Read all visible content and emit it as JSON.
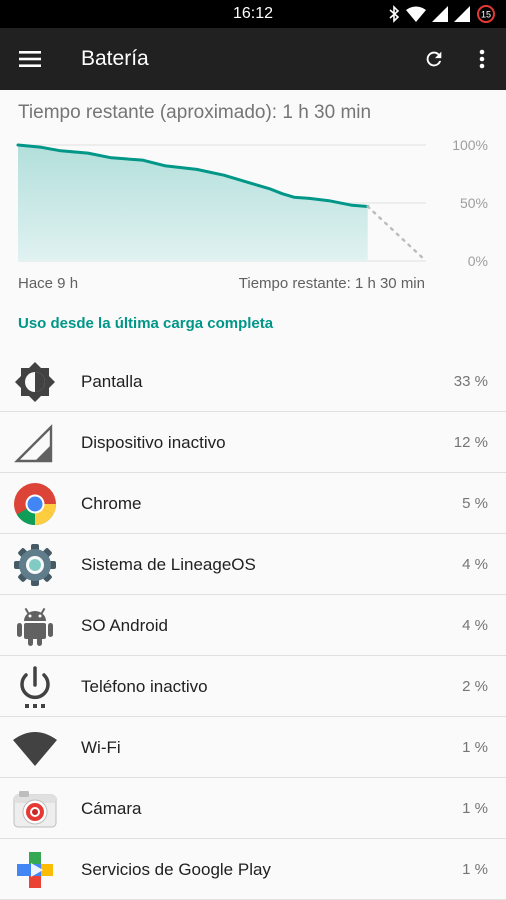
{
  "status_bar": {
    "time": "16:12",
    "icons": [
      "bluetooth-icon",
      "wifi-icon",
      "signal-icon",
      "signal-icon",
      "battery-saver-icon"
    ],
    "battery_level": "15"
  },
  "app_bar": {
    "title": "Batería",
    "actions": [
      "menu-icon",
      "refresh-icon",
      "more-vert-icon"
    ]
  },
  "battery": {
    "remaining_title": "Tiempo restante (aproximado): 1 h 30 min"
  },
  "chart_data": {
    "type": "area",
    "title": "",
    "x_range_label_start": "Hace 9 h",
    "x_range_label_end": "Tiempo restante: 1 h 30 min",
    "y_tick_labels": [
      "100%",
      "50%",
      "0%"
    ],
    "ylim": [
      0,
      100
    ],
    "grid": true,
    "series": [
      {
        "x_hours": [
          0,
          0.6,
          1.1,
          1.8,
          2.4,
          3.2,
          3.8,
          4.6,
          5.3,
          6.0,
          6.5,
          6.8,
          7.1,
          7.5,
          8.0,
          8.6,
          9.0
        ],
        "y": [
          100,
          98,
          95,
          93,
          89,
          87,
          82,
          79,
          74,
          67,
          62,
          58,
          55,
          54,
          52,
          48,
          47
        ]
      }
    ],
    "projection": {
      "x_hours": [
        9.0,
        10.5
      ],
      "y": [
        47,
        0
      ]
    },
    "colors": {
      "line": "#009688",
      "fill_top": "#b2dfdb",
      "fill_bottom": "#e0f2f1",
      "projection": "#bdbdbd"
    }
  },
  "usage": {
    "header": "Uso desde la última carga completa",
    "items": [
      {
        "name": "pantalla",
        "icon": "brightness-icon",
        "label": "Pantalla",
        "value": "33 %"
      },
      {
        "name": "dispositivo-inactivo",
        "icon": "cell-standby-icon",
        "label": "Dispositivo inactivo",
        "value": "12 %"
      },
      {
        "name": "chrome",
        "icon": "chrome-icon",
        "label": "Chrome",
        "value": "5 %"
      },
      {
        "name": "sistema-lineageos",
        "icon": "gear-icon",
        "label": "Sistema de LineageOS",
        "value": "4 %"
      },
      {
        "name": "so-android",
        "icon": "android-icon",
        "label": "SO Android",
        "value": "4 %"
      },
      {
        "name": "telefono-inactivo",
        "icon": "power-icon",
        "label": "Teléfono inactivo",
        "value": "2 %"
      },
      {
        "name": "wifi",
        "icon": "wifi-icon",
        "label": "Wi-Fi",
        "value": "1 %"
      },
      {
        "name": "camara",
        "icon": "camera-icon",
        "label": "Cámara",
        "value": "1 %"
      },
      {
        "name": "google-play-services",
        "icon": "google-play-services-icon",
        "label": "Servicios de Google Play",
        "value": "1 %"
      }
    ]
  }
}
